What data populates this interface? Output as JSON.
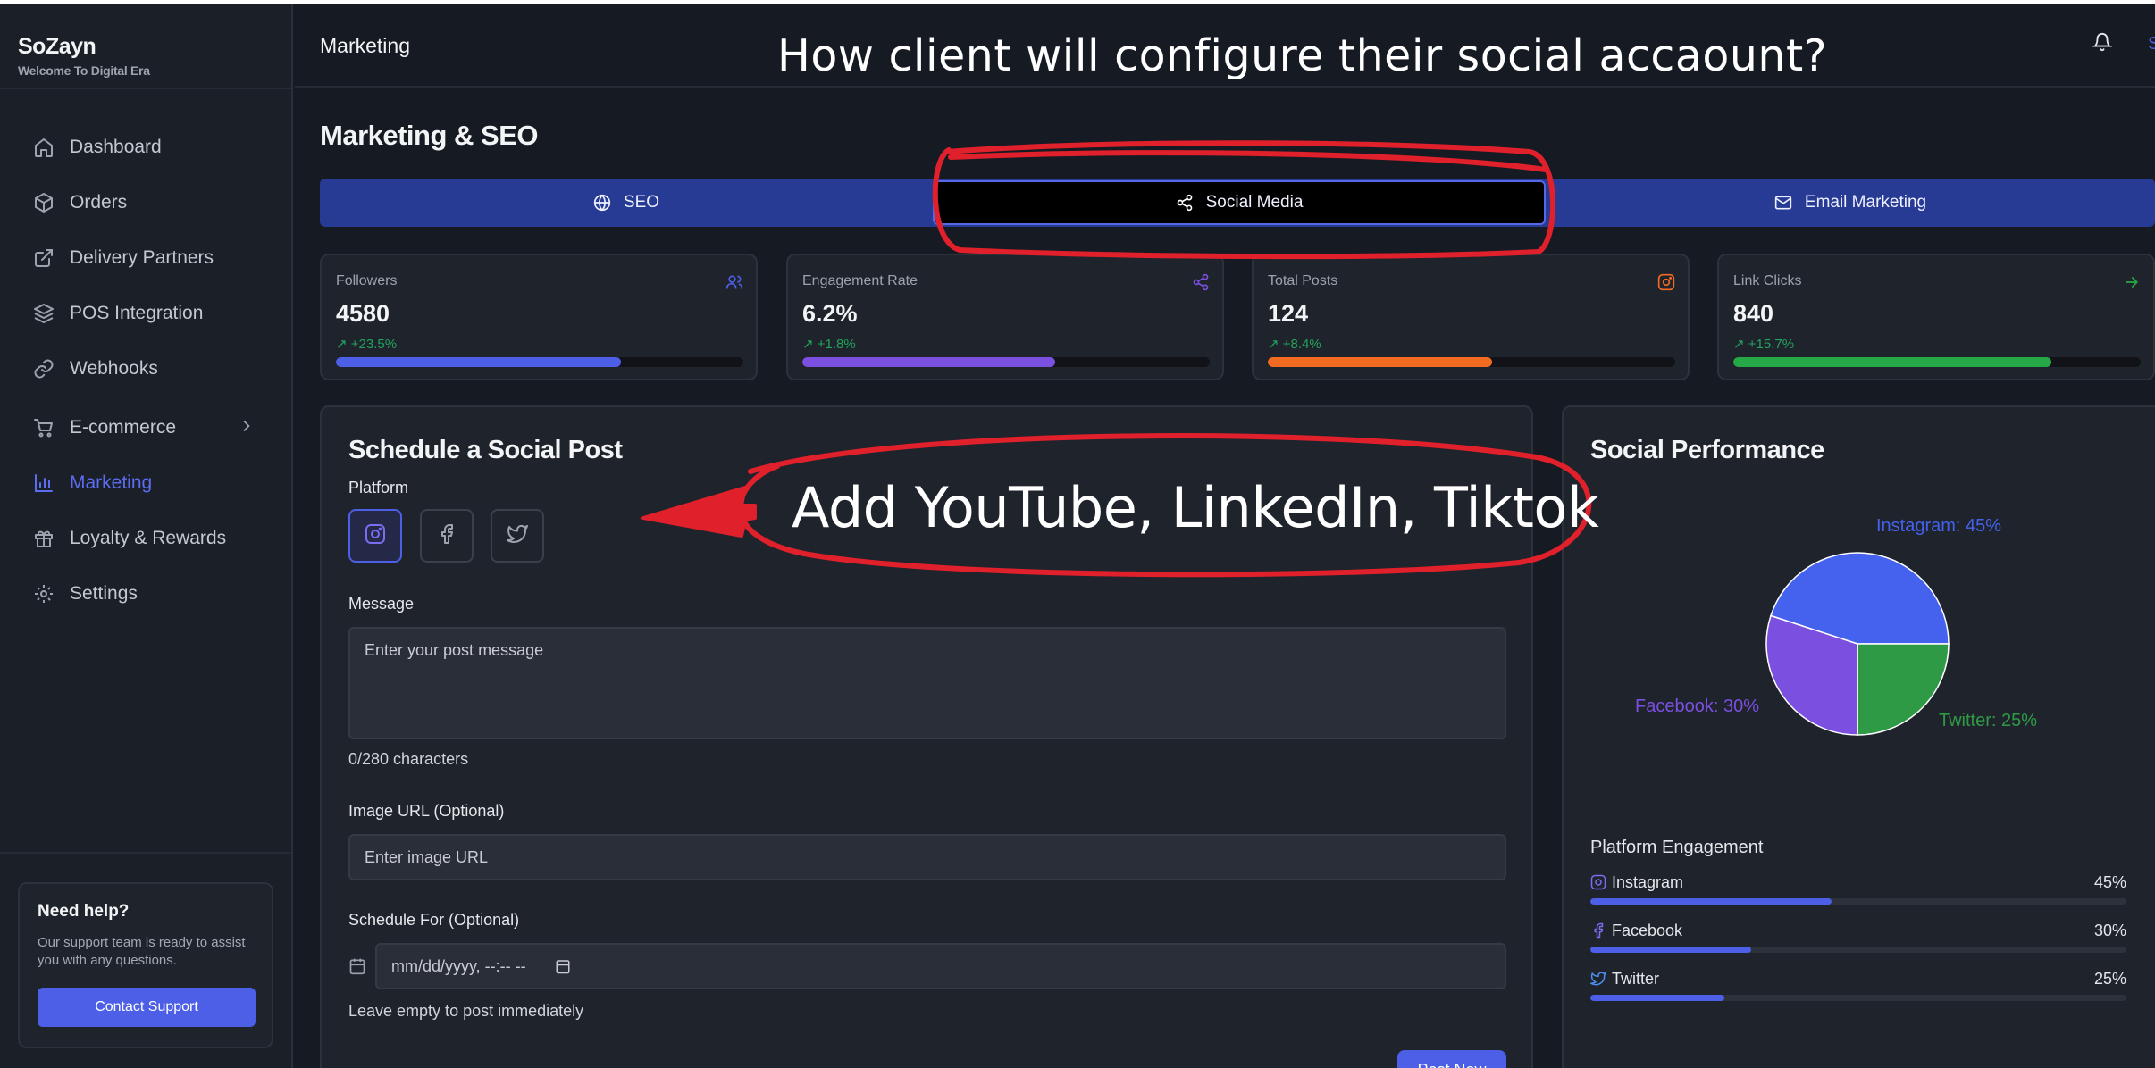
{
  "brand": {
    "title": "SoZayn",
    "subtitle": "Welcome To Digital Era"
  },
  "sidebar": {
    "items": [
      {
        "label": "Dashboard",
        "icon": "home-icon"
      },
      {
        "label": "Orders",
        "icon": "box-icon"
      },
      {
        "label": "Delivery Partners",
        "icon": "external-link-icon"
      },
      {
        "label": "POS Integration",
        "icon": "layers-icon"
      },
      {
        "label": "Webhooks",
        "icon": "link-icon"
      },
      {
        "label": "E-commerce",
        "icon": "cart-icon"
      },
      {
        "label": "Marketing",
        "icon": "bar-chart-icon",
        "active": true
      },
      {
        "label": "Loyalty & Rewards",
        "icon": "gift-icon"
      },
      {
        "label": "Settings",
        "icon": "gear-icon"
      }
    ]
  },
  "help": {
    "title": "Need help?",
    "text": "Our support team is ready to assist you with any questions.",
    "button": "Contact Support"
  },
  "header": {
    "title": "Marketing",
    "overflow_initial": "S"
  },
  "annotations": {
    "question": "How client will configure their social accaount?",
    "request": "Add YouTube, LinkedIn, Tiktok",
    "color": "#e0202a"
  },
  "page_title": "Marketing & SEO",
  "tabs": [
    {
      "label": "SEO",
      "icon": "globe-icon"
    },
    {
      "label": "Social Media",
      "icon": "share-icon",
      "active": true
    },
    {
      "label": "Email Marketing",
      "icon": "mail-icon"
    }
  ],
  "stats": [
    {
      "label": "Followers",
      "value": "4580",
      "change": "+23.5%",
      "progress": 0.7,
      "color": "#4c5fe6",
      "icon": "users-icon"
    },
    {
      "label": "Engagement Rate",
      "value": "6.2%",
      "change": "+1.8%",
      "progress": 0.62,
      "color": "#7b4fe0",
      "icon": "share-icon"
    },
    {
      "label": "Total Posts",
      "value": "124",
      "change": "+8.4%",
      "progress": 0.55,
      "color": "#f26b21",
      "icon": "instagram-icon"
    },
    {
      "label": "Link Clicks",
      "value": "840",
      "change": "+15.7%",
      "progress": 0.78,
      "color": "#27a846",
      "icon": "arrow-right-icon"
    }
  ],
  "schedule": {
    "title": "Schedule a Social Post",
    "platform_label": "Platform",
    "platforms": [
      "instagram-icon",
      "facebook-icon",
      "twitter-icon"
    ],
    "message_label": "Message",
    "message_placeholder": "Enter your post message",
    "char_count": "0/280 characters",
    "image_label": "Image URL (Optional)",
    "image_placeholder": "Enter image URL",
    "schedule_label": "Schedule For (Optional)",
    "schedule_placeholder": "mm/dd/yyyy, --:-- --",
    "schedule_helper": "Leave empty to post immediately",
    "post_button": "Post Now"
  },
  "performance": {
    "title": "Social Performance",
    "engagement_title": "Platform Engagement",
    "engagement": [
      {
        "name": "Instagram",
        "pct": "45%",
        "value": 45,
        "icon": "instagram-icon"
      },
      {
        "name": "Facebook",
        "pct": "30%",
        "value": 30,
        "icon": "facebook-icon"
      },
      {
        "name": "Twitter",
        "pct": "25%",
        "value": 25,
        "icon": "twitter-icon"
      }
    ]
  },
  "chart_data": {
    "type": "pie",
    "categories": [
      "Instagram",
      "Twitter",
      "Facebook"
    ],
    "values": [
      45,
      25,
      30
    ],
    "labels": [
      "Instagram: 45%",
      "Twitter: 25%",
      "Facebook: 30%"
    ],
    "colors": [
      "#4462ee",
      "#2f9a45",
      "#7b4fe0"
    ]
  }
}
